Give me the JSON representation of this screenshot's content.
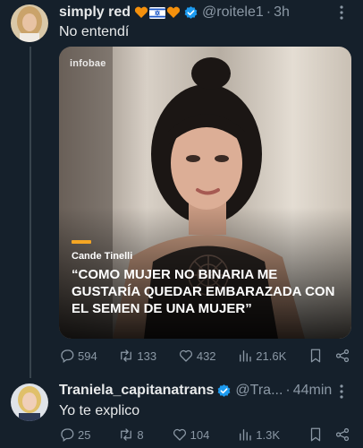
{
  "main_tweet": {
    "display_name": "simply red",
    "handle": "@roitele1",
    "time": "3h",
    "text": "No entendí",
    "media": {
      "logo": "infobae",
      "caption_name": "Cande Tinelli",
      "caption_quote": "“COMO MUJER NO BINARIA ME GUSTARÍA QUEDAR EMBARAZADA CON EL SEMEN DE UNA MUJER”"
    },
    "stats": {
      "replies": "594",
      "retweets": "133",
      "likes": "432",
      "views": "21.6K"
    }
  },
  "reply_tweet": {
    "display_name": "Traniela_capitanatrans",
    "handle": "@Tra...",
    "time": "44min",
    "text": "Yo te explico",
    "stats": {
      "replies": "25",
      "retweets": "8",
      "likes": "104",
      "views": "1.3K"
    }
  },
  "colors": {
    "background": "#15202b",
    "text": "#e7e9ea",
    "muted": "#8b98a5",
    "verified": "#1d9bf0",
    "accent_caption": "#f5a623"
  },
  "icons": [
    "orange-heart-icon",
    "israel-flag-icon",
    "verified-badge-icon",
    "more-icon",
    "reply-icon",
    "retweet-icon",
    "like-icon",
    "views-icon",
    "bookmark-icon",
    "share-icon"
  ]
}
